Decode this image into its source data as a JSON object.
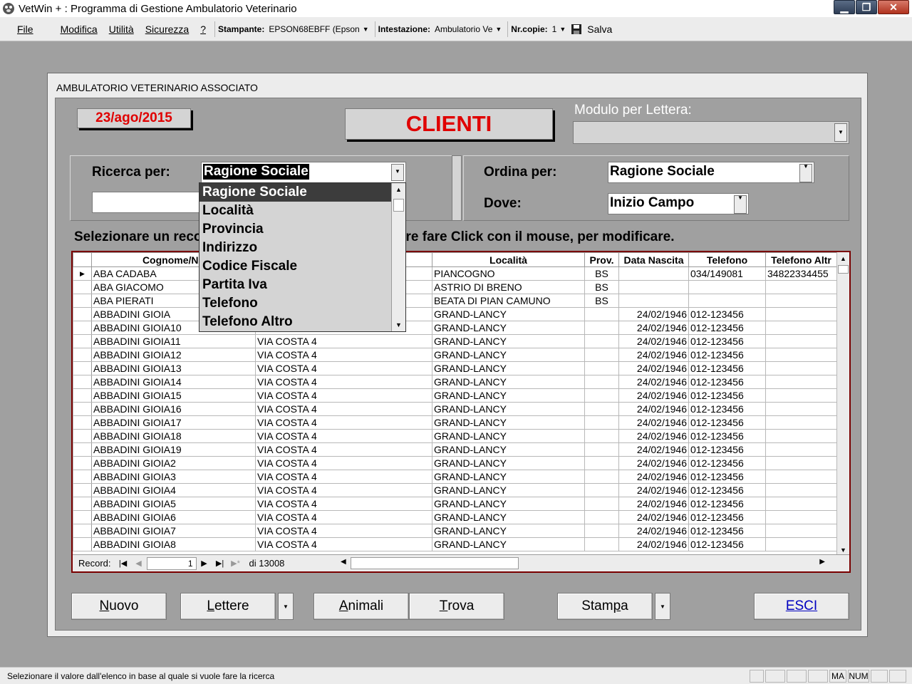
{
  "window": {
    "title": "VetWin + : Programma di Gestione Ambulatorio Veterinario",
    "buttons": {
      "minimize": "▁",
      "maximize": "❐",
      "close": "✕"
    }
  },
  "menu": {
    "items": [
      "File",
      "Modifica",
      "Utilità",
      "Sicurezza",
      "?"
    ],
    "stampante_label": "Stampante:",
    "stampante_value": "EPSON68EBFF (Epson",
    "intestazione_label": "Intestazione:",
    "intestazione_value": "Ambulatorio Ve",
    "copie_label": "Nr.copie:",
    "copie_value": "1",
    "save_label": "Salva"
  },
  "form": {
    "title": "AMBULATORIO VETERINARIO ASSOCIATO",
    "date": "23/ago/2015",
    "heading": "CLIENTI",
    "modulo_label": "Modulo per Lettera:",
    "modulo_value": "",
    "search_label": "Ricerca per:",
    "search_value": "Ragione Sociale",
    "search_input": "",
    "order_label": "Ordina per:",
    "order_value": "Ragione Sociale",
    "dove_label": "Dove:",
    "dove_value": "Inizio Campo",
    "hint_prefix": "Selezionare un reco",
    "hint_suffix": "re fare Click con il mouse, per modificare."
  },
  "dropdown": {
    "items": [
      "Ragione Sociale",
      "Località",
      "Provincia",
      "Indirizzo",
      "Codice Fiscale",
      "Partita Iva",
      "Telefono",
      "Telefono Altro"
    ],
    "selected": 0
  },
  "grid": {
    "columns": [
      "Cognome/No",
      "",
      "Località",
      "Prov.",
      "Data Nascita",
      "Telefono",
      "Telefono Altr"
    ],
    "rows": [
      [
        "ABA CADABA",
        "",
        "PIANCOGNO",
        "BS",
        "",
        "034/149081",
        "34822334455"
      ],
      [
        "ABA GIACOMO",
        "",
        "ASTRIO DI BRENO",
        "BS",
        "",
        "",
        ""
      ],
      [
        "ABA PIERATI",
        "",
        "BEATA DI PIAN CAMUNO",
        "BS",
        "",
        "",
        ""
      ],
      [
        "ABBADINI GIOIA",
        "",
        "GRAND-LANCY",
        "",
        "24/02/1946",
        "012-123456",
        ""
      ],
      [
        "ABBADINI GIOIA10",
        "",
        "GRAND-LANCY",
        "",
        "24/02/1946",
        "012-123456",
        ""
      ],
      [
        "ABBADINI GIOIA11",
        "VIA COSTA 4",
        "GRAND-LANCY",
        "",
        "24/02/1946",
        "012-123456",
        ""
      ],
      [
        "ABBADINI GIOIA12",
        "VIA COSTA 4",
        "GRAND-LANCY",
        "",
        "24/02/1946",
        "012-123456",
        ""
      ],
      [
        "ABBADINI GIOIA13",
        "VIA COSTA 4",
        "GRAND-LANCY",
        "",
        "24/02/1946",
        "012-123456",
        ""
      ],
      [
        "ABBADINI GIOIA14",
        "VIA COSTA 4",
        "GRAND-LANCY",
        "",
        "24/02/1946",
        "012-123456",
        ""
      ],
      [
        "ABBADINI GIOIA15",
        "VIA COSTA 4",
        "GRAND-LANCY",
        "",
        "24/02/1946",
        "012-123456",
        ""
      ],
      [
        "ABBADINI GIOIA16",
        "VIA COSTA 4",
        "GRAND-LANCY",
        "",
        "24/02/1946",
        "012-123456",
        ""
      ],
      [
        "ABBADINI GIOIA17",
        "VIA COSTA 4",
        "GRAND-LANCY",
        "",
        "24/02/1946",
        "012-123456",
        ""
      ],
      [
        "ABBADINI GIOIA18",
        "VIA COSTA 4",
        "GRAND-LANCY",
        "",
        "24/02/1946",
        "012-123456",
        ""
      ],
      [
        "ABBADINI GIOIA19",
        "VIA COSTA 4",
        "GRAND-LANCY",
        "",
        "24/02/1946",
        "012-123456",
        ""
      ],
      [
        "ABBADINI GIOIA2",
        "VIA COSTA 4",
        "GRAND-LANCY",
        "",
        "24/02/1946",
        "012-123456",
        ""
      ],
      [
        "ABBADINI GIOIA3",
        "VIA COSTA 4",
        "GRAND-LANCY",
        "",
        "24/02/1946",
        "012-123456",
        ""
      ],
      [
        "ABBADINI GIOIA4",
        "VIA COSTA 4",
        "GRAND-LANCY",
        "",
        "24/02/1946",
        "012-123456",
        ""
      ],
      [
        "ABBADINI GIOIA5",
        "VIA COSTA 4",
        "GRAND-LANCY",
        "",
        "24/02/1946",
        "012-123456",
        ""
      ],
      [
        "ABBADINI GIOIA6",
        "VIA COSTA 4",
        "GRAND-LANCY",
        "",
        "24/02/1946",
        "012-123456",
        ""
      ],
      [
        "ABBADINI GIOIA7",
        "VIA COSTA 4",
        "GRAND-LANCY",
        "",
        "24/02/1946",
        "012-123456",
        ""
      ],
      [
        "ABBADINI GIOIA8",
        "VIA COSTA 4",
        "GRAND-LANCY",
        "",
        "24/02/1946",
        "012-123456",
        ""
      ]
    ],
    "record_label": "Record:",
    "record_position": "1",
    "record_total": "di 13008"
  },
  "buttons": {
    "nuovo": {
      "hot": "N",
      "rest": "uovo"
    },
    "lettere": {
      "hot": "L",
      "rest": "ettere"
    },
    "animali": {
      "hot": "A",
      "rest": "nimali"
    },
    "trova": {
      "hot": "T",
      "rest": "rova"
    },
    "stampa": {
      "pre": "Stam",
      "hot": "p",
      "rest": "a"
    },
    "esci": "ESCI"
  },
  "status": {
    "text": "Selezionare il valore dall'elenco in base al quale si vuole fare la ricerca",
    "caps": "MA",
    "num": "NUM"
  },
  "colors": {
    "accent_red": "#e00000",
    "grid_border": "#7a0000",
    "link_blue": "#0000c0"
  }
}
